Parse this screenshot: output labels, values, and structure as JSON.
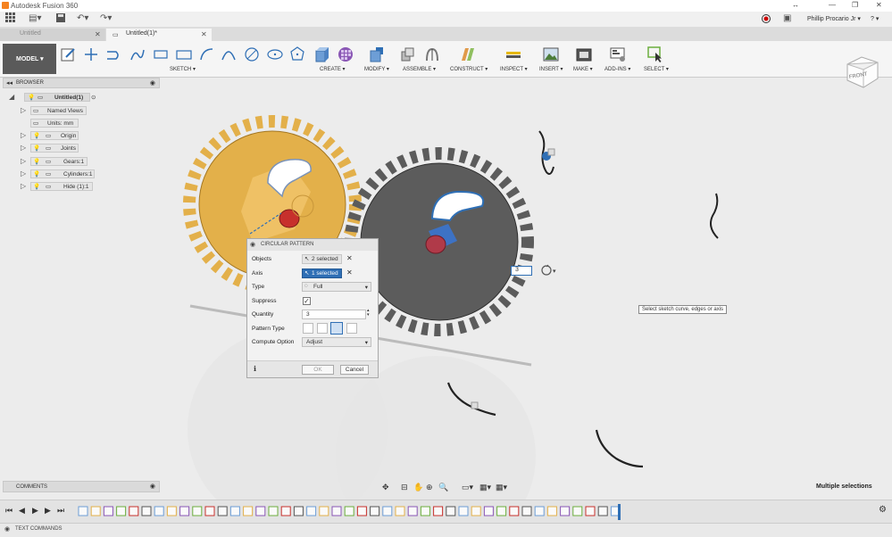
{
  "window": {
    "title": "Autodesk Fusion 360",
    "user": "Phillip Procario Jr ▾",
    "help": "? ▾"
  },
  "tabs": [
    {
      "label": "Untitled"
    },
    {
      "label": "Untitled(1)*"
    }
  ],
  "ribbon": {
    "mode": "MODEL ▾",
    "groups": [
      {
        "label": "SKETCH ▾"
      },
      {
        "label": "CREATE ▾"
      },
      {
        "label": "MODIFY ▾"
      },
      {
        "label": "ASSEMBLE ▾"
      },
      {
        "label": "CONSTRUCT ▾"
      },
      {
        "label": "INSPECT ▾"
      },
      {
        "label": "INSERT ▾"
      },
      {
        "label": "MAKE ▾"
      },
      {
        "label": "ADD-INS ▾"
      },
      {
        "label": "SELECT ▾"
      }
    ]
  },
  "viewcube": {
    "face": "FRONT"
  },
  "browser": {
    "title": "BROWSER",
    "root": "Untitled(1)",
    "items": [
      {
        "label": "Named Views"
      },
      {
        "label": "Units: mm"
      },
      {
        "label": "Origin"
      },
      {
        "label": "Joints"
      },
      {
        "label": "Gears:1"
      },
      {
        "label": "Cylinders:1"
      },
      {
        "label": "Hide (1):1"
      }
    ]
  },
  "dialog": {
    "title": "CIRCULAR PATTERN",
    "rows": [
      {
        "label": "Objects",
        "value": "2 selected"
      },
      {
        "label": "Axis",
        "value": "1 selected"
      },
      {
        "label": "Type",
        "value": "Full"
      },
      {
        "label": "Suppress"
      },
      {
        "label": "Quantity",
        "value": "3"
      },
      {
        "label": "Pattern Type"
      },
      {
        "label": "Compute Option",
        "value": "Adjust"
      }
    ],
    "ok": "OK",
    "cancel": "Cancel"
  },
  "canvas": {
    "quantity_field": "3"
  },
  "tooltip": "Select sketch curve, edges or axis",
  "comments": "COMMENTS",
  "status": "Multiple selections",
  "text_commands": "TEXT COMMANDS",
  "colors": {
    "accent": "#1e78c8",
    "gear_gold": "#e3b04a",
    "gear_dark": "#555555",
    "selection": "#2f6fb5"
  }
}
